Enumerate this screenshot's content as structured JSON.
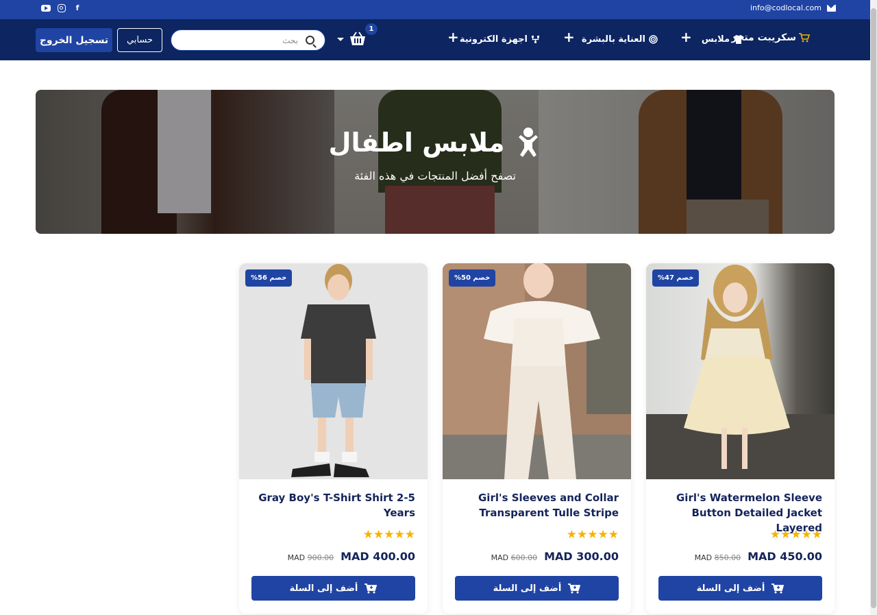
{
  "topbar": {
    "email": "info@codlocal.com",
    "social_icons": [
      "youtube-icon",
      "instagram-icon",
      "facebook-icon"
    ]
  },
  "nav": {
    "brand": "سكريبت متجر",
    "menu": [
      {
        "label": "ملابس",
        "icon": "shirt-icon"
      },
      {
        "label": "العناية بالبشرة",
        "icon": "target-icon"
      },
      {
        "label": "اجهزة الكترونية",
        "icon": "network-icon"
      }
    ],
    "cart_count": "1",
    "search_placeholder": "بحث",
    "account_label": "حسابي",
    "logout_label": "تسجيل الخروج"
  },
  "hero": {
    "title": "ملابس اطفال",
    "subtitle": "تصفح أفضل المنتجات في هذه الفئة"
  },
  "products": [
    {
      "title": "Girl's Watermelon Sleeve Button Detailed Jacket Layered",
      "badge": "خصم 47%",
      "rating": 5,
      "new_price": "MAD 450.00",
      "old_currency": "MAD",
      "old_price": "850.00",
      "button": "أضف إلى السلة"
    },
    {
      "title": "Girl's Sleeves and Collar Transparent Tulle Stripe",
      "badge": "خصم 50%",
      "rating": 5,
      "new_price": "MAD 300.00",
      "old_currency": "MAD",
      "old_price": "600.00",
      "button": "أضف إلى السلة"
    },
    {
      "title": "Gray Boy's T-Shirt Shirt 2-5 Years",
      "badge": "خصم 56%",
      "rating": 5,
      "new_price": "MAD 400.00",
      "old_currency": "MAD",
      "old_price": "900.00",
      "button": "أضف إلى السلة"
    }
  ],
  "colors": {
    "primary": "#1f44a3",
    "nav_bg": "#0d2560",
    "star": "#f5b301"
  }
}
